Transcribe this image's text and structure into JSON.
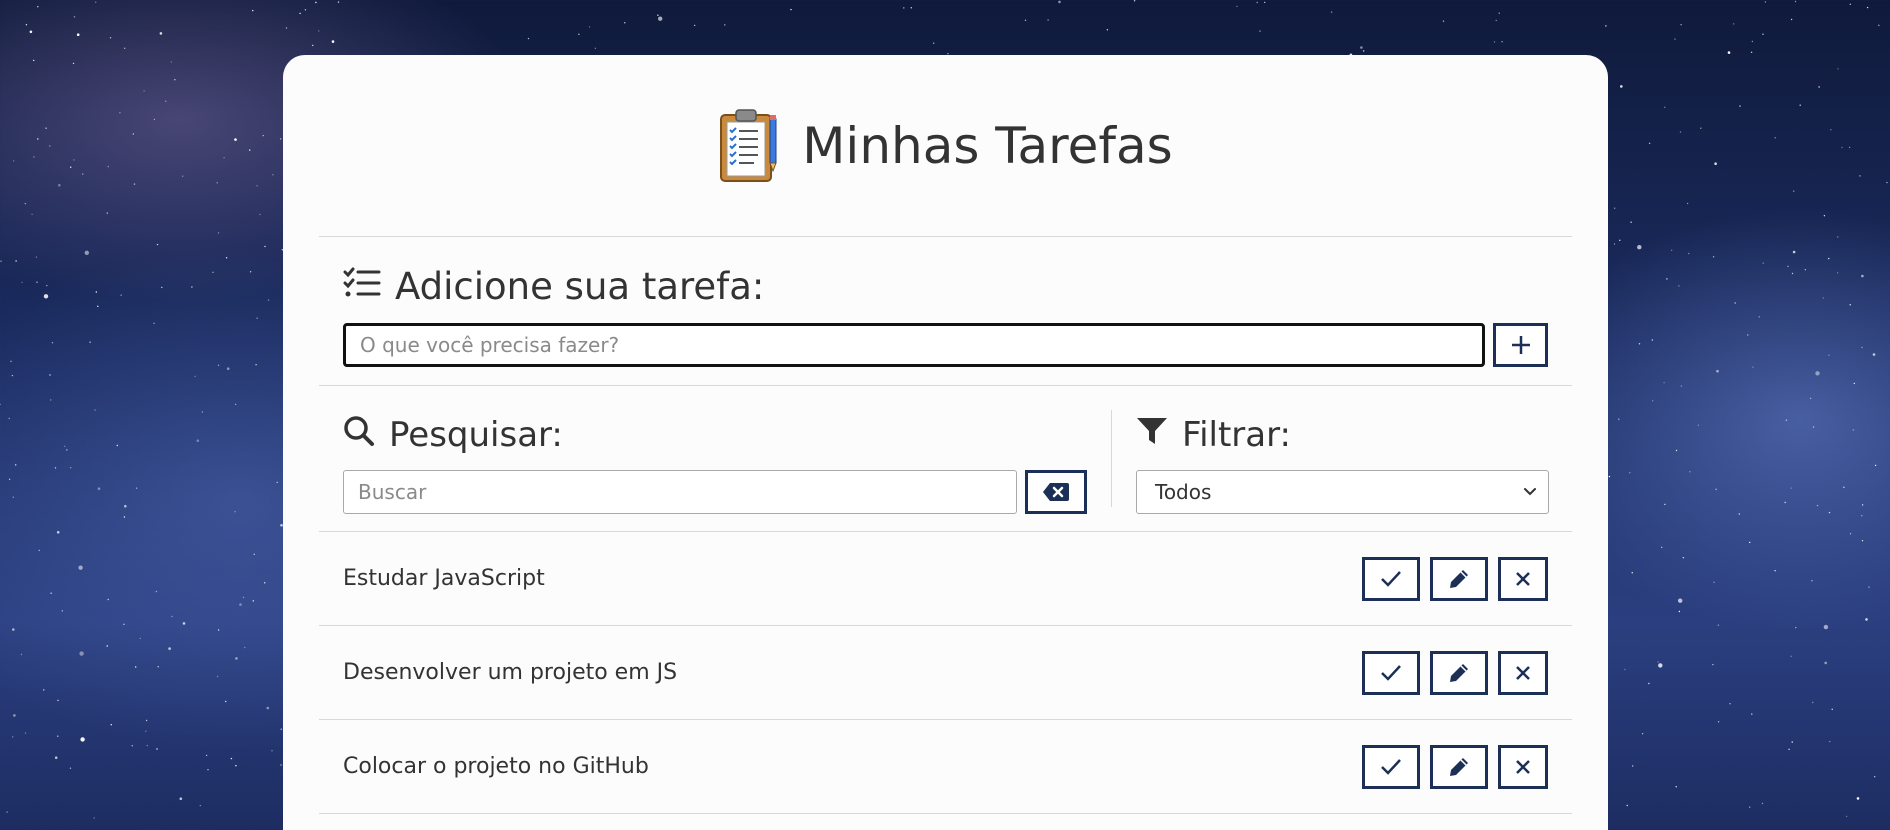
{
  "colors": {
    "accent": "#1b2f57",
    "card_background": "#fcfcfc",
    "text": "#333333",
    "divider": "#d8d8d8"
  },
  "header": {
    "title": "Minhas Tarefas",
    "icon": "clipboard-icon"
  },
  "add_todo": {
    "title": "Adicione sua tarefa:",
    "title_icon": "checklist-icon",
    "input_value": "",
    "input_placeholder": "O que você precisa fazer?",
    "add_button_icon": "plus-icon"
  },
  "search": {
    "title": "Pesquisar:",
    "title_icon": "magnifier-icon",
    "input_value": "",
    "input_placeholder": "Buscar",
    "clear_button_icon": "backspace-icon"
  },
  "filter": {
    "title": "Filtrar:",
    "title_icon": "funnel-icon",
    "selected": "Todos"
  },
  "todos": [
    {
      "text": "Estudar JavaScript"
    },
    {
      "text": "Desenvolver um projeto em JS"
    },
    {
      "text": "Colocar o projeto no GitHub"
    }
  ]
}
